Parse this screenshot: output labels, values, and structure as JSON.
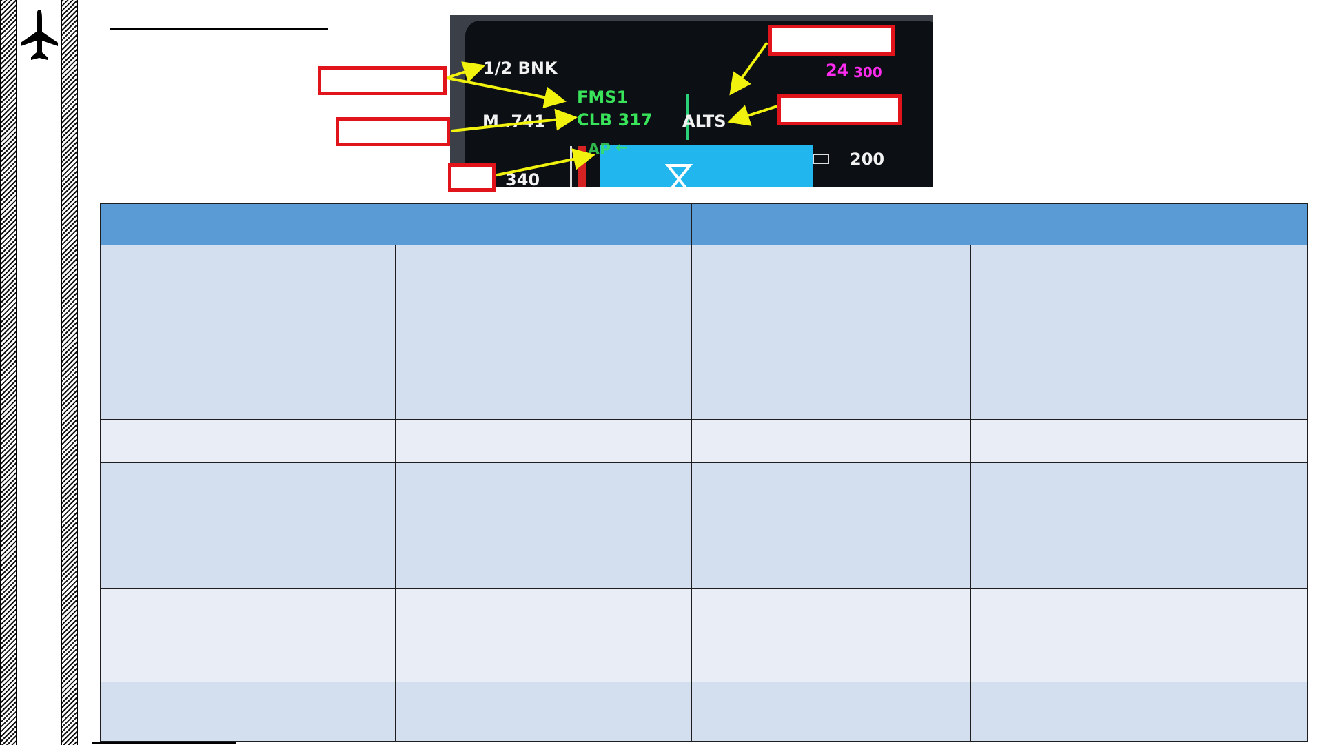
{
  "pfd": {
    "bank_label": "1/2 BNK",
    "lateral_mode": "FMS1",
    "vertical_mode": "CLB 317",
    "mach": "M .741",
    "armed_altitude": "ALTS",
    "altitude_select_large": "24",
    "altitude_select_small": "300",
    "autopilot": "AP",
    "autopilot_arrow": "←",
    "speed_value": "340",
    "altitude_value": "200"
  },
  "colors": {
    "callout": "#e0141a",
    "arrow": "#f2f20f",
    "header": "#5b9bd5",
    "row_dark": "#d3deee",
    "row_light": "#e9edf6"
  },
  "table": {
    "headers": [
      "",
      ""
    ],
    "rows": [
      [
        "",
        "",
        "",
        ""
      ],
      [
        "",
        "",
        "",
        ""
      ],
      [
        "",
        "",
        "",
        ""
      ],
      [
        "",
        "",
        "",
        ""
      ],
      [
        "",
        "",
        "",
        ""
      ]
    ]
  }
}
